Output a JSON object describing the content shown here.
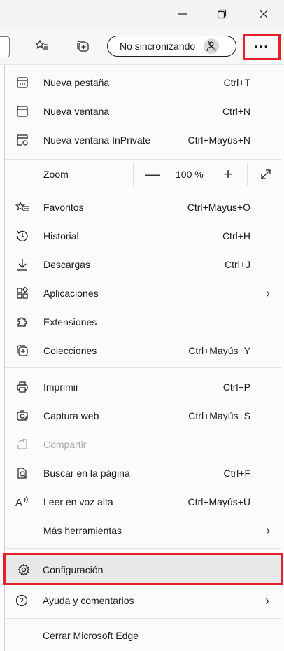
{
  "window": {
    "minimize_icon": "minimize-icon",
    "restore_icon": "restore-icon",
    "close_icon": "close-icon"
  },
  "toolbar": {
    "profile_label": "No sincronizando",
    "more_label": "···"
  },
  "menu": {
    "new_tab": {
      "label": "Nueva pestaña",
      "shortcut": "Ctrl+T"
    },
    "new_window": {
      "label": "Nueva ventana",
      "shortcut": "Ctrl+N"
    },
    "new_inprivate": {
      "label": "Nueva ventana InPrivate",
      "shortcut": "Ctrl+Mayús+N"
    },
    "zoom": {
      "label": "Zoom",
      "minus": "—",
      "value": "100 %",
      "plus": "+"
    },
    "favorites": {
      "label": "Favoritos",
      "shortcut": "Ctrl+Mayús+O"
    },
    "history": {
      "label": "Historial",
      "shortcut": "Ctrl+H"
    },
    "downloads": {
      "label": "Descargas",
      "shortcut": "Ctrl+J"
    },
    "apps": {
      "label": "Aplicaciones"
    },
    "extensions": {
      "label": "Extensiones"
    },
    "collections": {
      "label": "Colecciones",
      "shortcut": "Ctrl+Mayús+Y"
    },
    "print": {
      "label": "Imprimir",
      "shortcut": "Ctrl+P"
    },
    "web_capture": {
      "label": "Captura web",
      "shortcut": "Ctrl+Mayús+S"
    },
    "share": {
      "label": "Compartir"
    },
    "find": {
      "label": "Buscar en la página",
      "shortcut": "Ctrl+F"
    },
    "read_aloud": {
      "label": "Leer en voz alta",
      "shortcut": "Ctrl+Mayús+U"
    },
    "more_tools": {
      "label": "Más herramientas"
    },
    "settings": {
      "label": "Configuración"
    },
    "help": {
      "label": "Ayuda y comentarios"
    },
    "close_edge": {
      "label": "Cerrar Microsoft Edge"
    }
  },
  "colors": {
    "highlight": "#e3202c",
    "menu_bg": "#fbfbfb",
    "hover_bg": "#e8e8e8"
  }
}
